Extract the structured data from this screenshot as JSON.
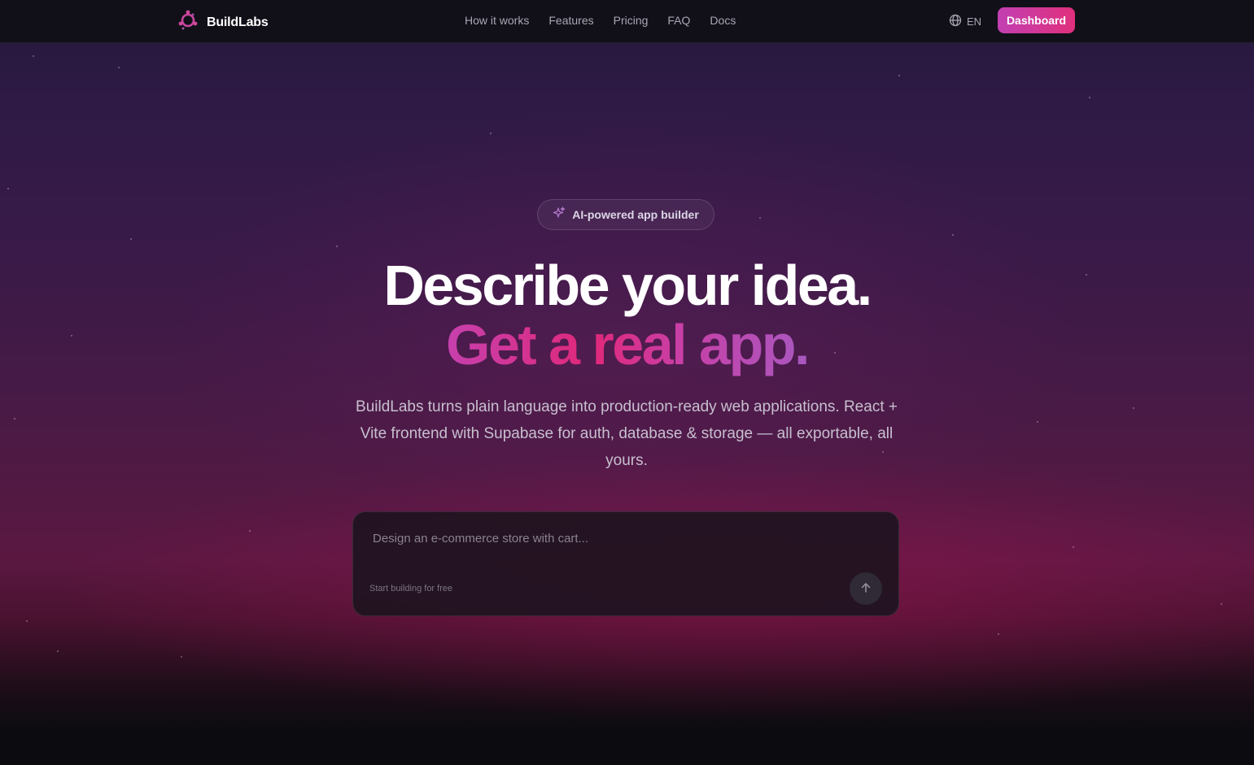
{
  "brand": {
    "name": "BuildLabs"
  },
  "nav": {
    "links": [
      "How it works",
      "Features",
      "Pricing",
      "FAQ",
      "Docs"
    ],
    "language": "EN",
    "dashboard_label": "Dashboard"
  },
  "hero": {
    "badge": "AI-powered app builder",
    "headline_line1": "Describe your idea.",
    "headline_line2": "Get a real app.",
    "subtitle": "BuildLabs turns plain language into production-ready web applications. React + Vite frontend with Supabase for auth, database & storage — all exportable, all yours."
  },
  "prompt": {
    "placeholder": "Design an e-commerce store with cart...",
    "value": "",
    "hint": "Start building for free"
  },
  "icons": {
    "logo": "logo-icon",
    "globe": "globe-icon",
    "sparkle": "sparkles-icon",
    "send": "arrow-up-icon"
  },
  "colors": {
    "accent_start": "#c23fb3",
    "accent_end": "#e0307c",
    "header_bg": "#111018",
    "page_bg": "#0c0b10"
  }
}
